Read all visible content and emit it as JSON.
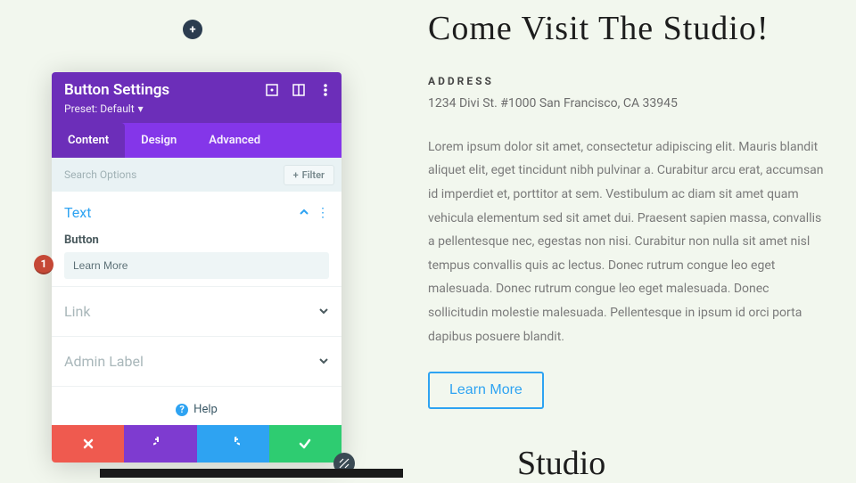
{
  "add_button": {
    "icon": "plus-icon"
  },
  "panel": {
    "title": "Button Settings",
    "preset_label": "Preset: Default",
    "tabs": [
      {
        "label": "Content",
        "active": true
      },
      {
        "label": "Design",
        "active": false
      },
      {
        "label": "Advanced",
        "active": false
      }
    ],
    "search": {
      "placeholder": "Search Options",
      "filter_label": "Filter"
    },
    "sections": {
      "text": {
        "title": "Text",
        "field_label": "Button",
        "field_value": "Learn More"
      },
      "link": {
        "title": "Link"
      },
      "admin_label": {
        "title": "Admin Label"
      }
    },
    "help_label": "Help"
  },
  "badge": "1",
  "page": {
    "heading": "Come Visit The Studio!",
    "address_label": "ADDRESS",
    "address": "1234 Divi St. #1000 San Francisco, CA 33945",
    "body": "Lorem ipsum dolor sit amet, consectetur adipiscing elit. Mauris blandit aliquet elit, eget tincidunt nibh pulvinar a. Curabitur arcu erat, accumsan id imperdiet et, porttitor at sem. Vestibulum ac diam sit amet quam vehicula elementum sed sit amet dui. Praesent sapien massa, convallis a pellentesque nec, egestas non nisi. Curabitur non nulla sit amet nisl tempus convallis quis ac lectus. Donec rutrum congue leo eget malesuada. Donec rutrum congue leo eget malesuada. Donec sollicitudin molestie malesuada. Pellentesque in ipsum id orci porta dapibus posuere blandit.",
    "cta_label": "Learn More",
    "bottom_heading": "Studio"
  }
}
